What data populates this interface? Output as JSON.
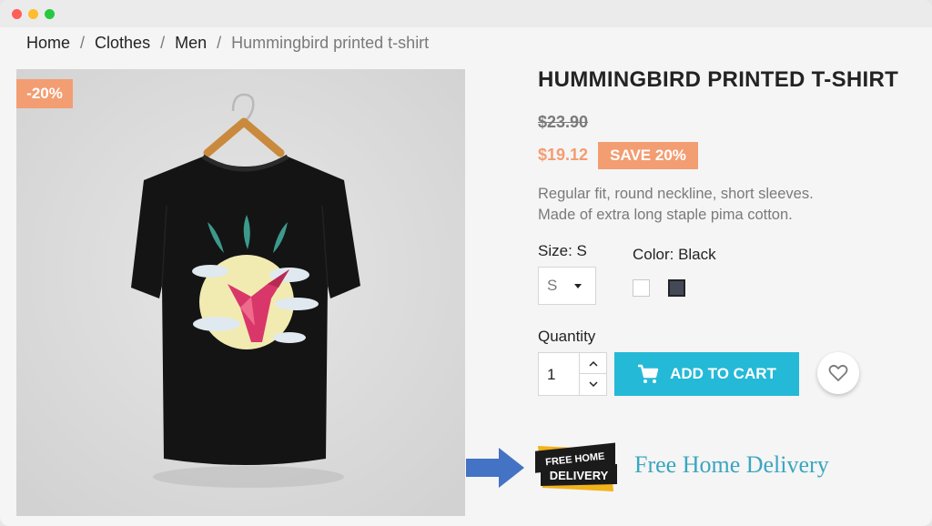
{
  "breadcrumb": {
    "items": [
      "Home",
      "Clothes",
      "Men"
    ],
    "current": "Hummingbird printed t-shirt",
    "separator": "/"
  },
  "product": {
    "discount_flag": "-20%",
    "title": "HUMMINGBIRD PRINTED T-SHIRT",
    "old_price": "$23.90",
    "new_price": "$19.12",
    "save_badge": "SAVE 20%",
    "description_line1": "Regular fit, round neckline, short sleeves.",
    "description_line2": "Made of extra long staple pima  cotton.",
    "image_icon": "tshirt-hummingbird-image"
  },
  "options": {
    "size_label": "Size: S",
    "size_value": "S",
    "color_label": "Color: Black",
    "colors": [
      "#ffffff",
      "#434a56"
    ]
  },
  "purchase": {
    "quantity_label": "Quantity",
    "quantity_value": "1",
    "add_to_cart_label": "ADD TO CART",
    "cart_icon": "cart-icon",
    "wishlist_icon": "heart-icon"
  },
  "delivery": {
    "logo_line1": "FREE HOME",
    "logo_line2": "DELIVERY",
    "text": "Free Home Delivery",
    "arrow_icon": "arrow-right-icon"
  },
  "colors": {
    "accent_orange": "#f39d72",
    "accent_blue": "#24b9d7",
    "delivery_text": "#3aa6bf",
    "arrow_blue": "#4472c4"
  }
}
